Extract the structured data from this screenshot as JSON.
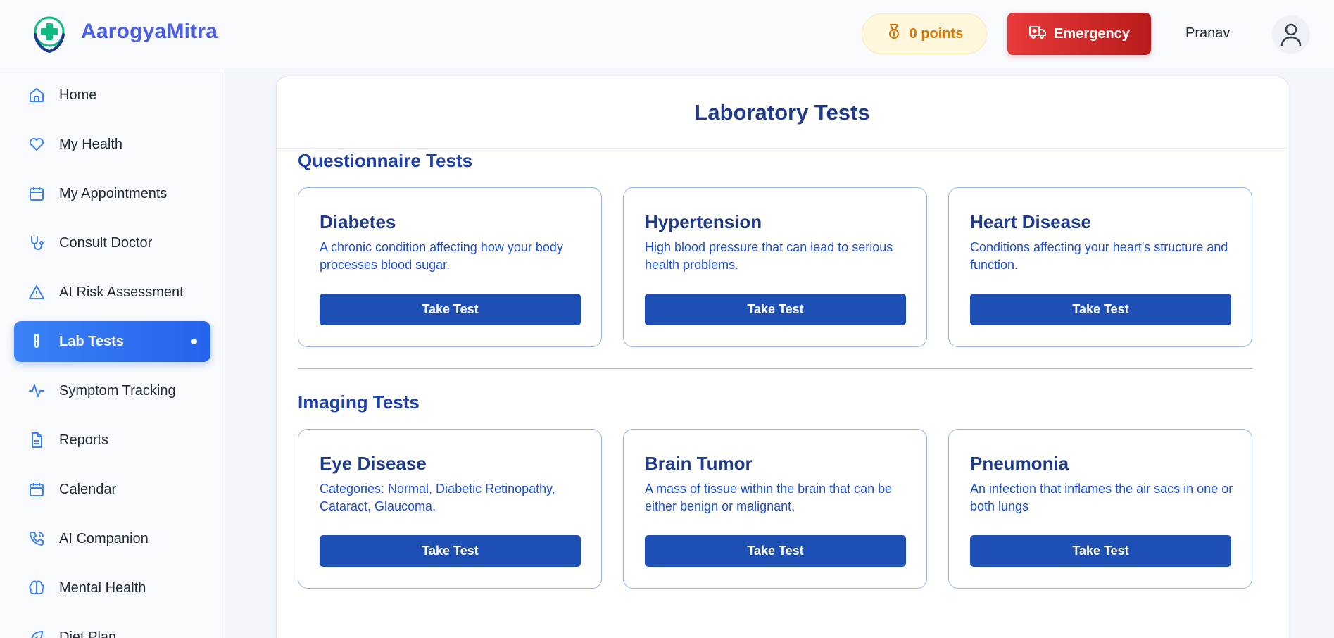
{
  "app": {
    "name": "AarogyaMitra"
  },
  "header": {
    "points_label": "0 points",
    "emergency_label": "Emergency",
    "username": "Pranav"
  },
  "sidebar": {
    "items": [
      {
        "label": "Home",
        "icon": "home-icon"
      },
      {
        "label": "My Health",
        "icon": "heart-icon"
      },
      {
        "label": "My Appointments",
        "icon": "calendar-icon"
      },
      {
        "label": "Consult Doctor",
        "icon": "stethoscope-icon"
      },
      {
        "label": "AI Risk Assessment",
        "icon": "warning-icon"
      },
      {
        "label": "Lab Tests",
        "icon": "test-tube-icon",
        "active": true
      },
      {
        "label": "Symptom Tracking",
        "icon": "activity-icon"
      },
      {
        "label": "Reports",
        "icon": "document-icon"
      },
      {
        "label": "Calendar",
        "icon": "calendar-icon"
      },
      {
        "label": "AI Companion",
        "icon": "phone-icon"
      },
      {
        "label": "Mental Health",
        "icon": "brain-icon"
      },
      {
        "label": "Diet Plan",
        "icon": "leaf-icon"
      }
    ]
  },
  "main": {
    "title": "Laboratory Tests",
    "sections": [
      {
        "title": "Questionnaire Tests",
        "tests": [
          {
            "name": "Diabetes",
            "description": "A chronic condition affecting how your body processes blood sugar.",
            "button": "Take Test"
          },
          {
            "name": "Hypertension",
            "description": "High blood pressure that can lead to serious health problems.",
            "button": "Take Test"
          },
          {
            "name": "Heart Disease",
            "description": "Conditions affecting your heart's structure and function.",
            "button": "Take Test"
          }
        ]
      },
      {
        "title": "Imaging Tests",
        "tests": [
          {
            "name": "Eye Disease",
            "description": "Categories: Normal, Diabetic Retinopathy, Cataract, Glaucoma.",
            "button": "Take Test"
          },
          {
            "name": "Brain Tumor",
            "description": "A mass of tissue within the brain that can be either benign or malignant.",
            "button": "Take Test"
          },
          {
            "name": "Pneumonia",
            "description": "An infection that inflames the air sacs in one or both lungs",
            "button": "Take Test"
          }
        ]
      }
    ]
  },
  "colors": {
    "brand": "#4a5ee8",
    "accent": "#2563eb",
    "emergency": "#dc2626",
    "button": "#1e4fb4"
  }
}
